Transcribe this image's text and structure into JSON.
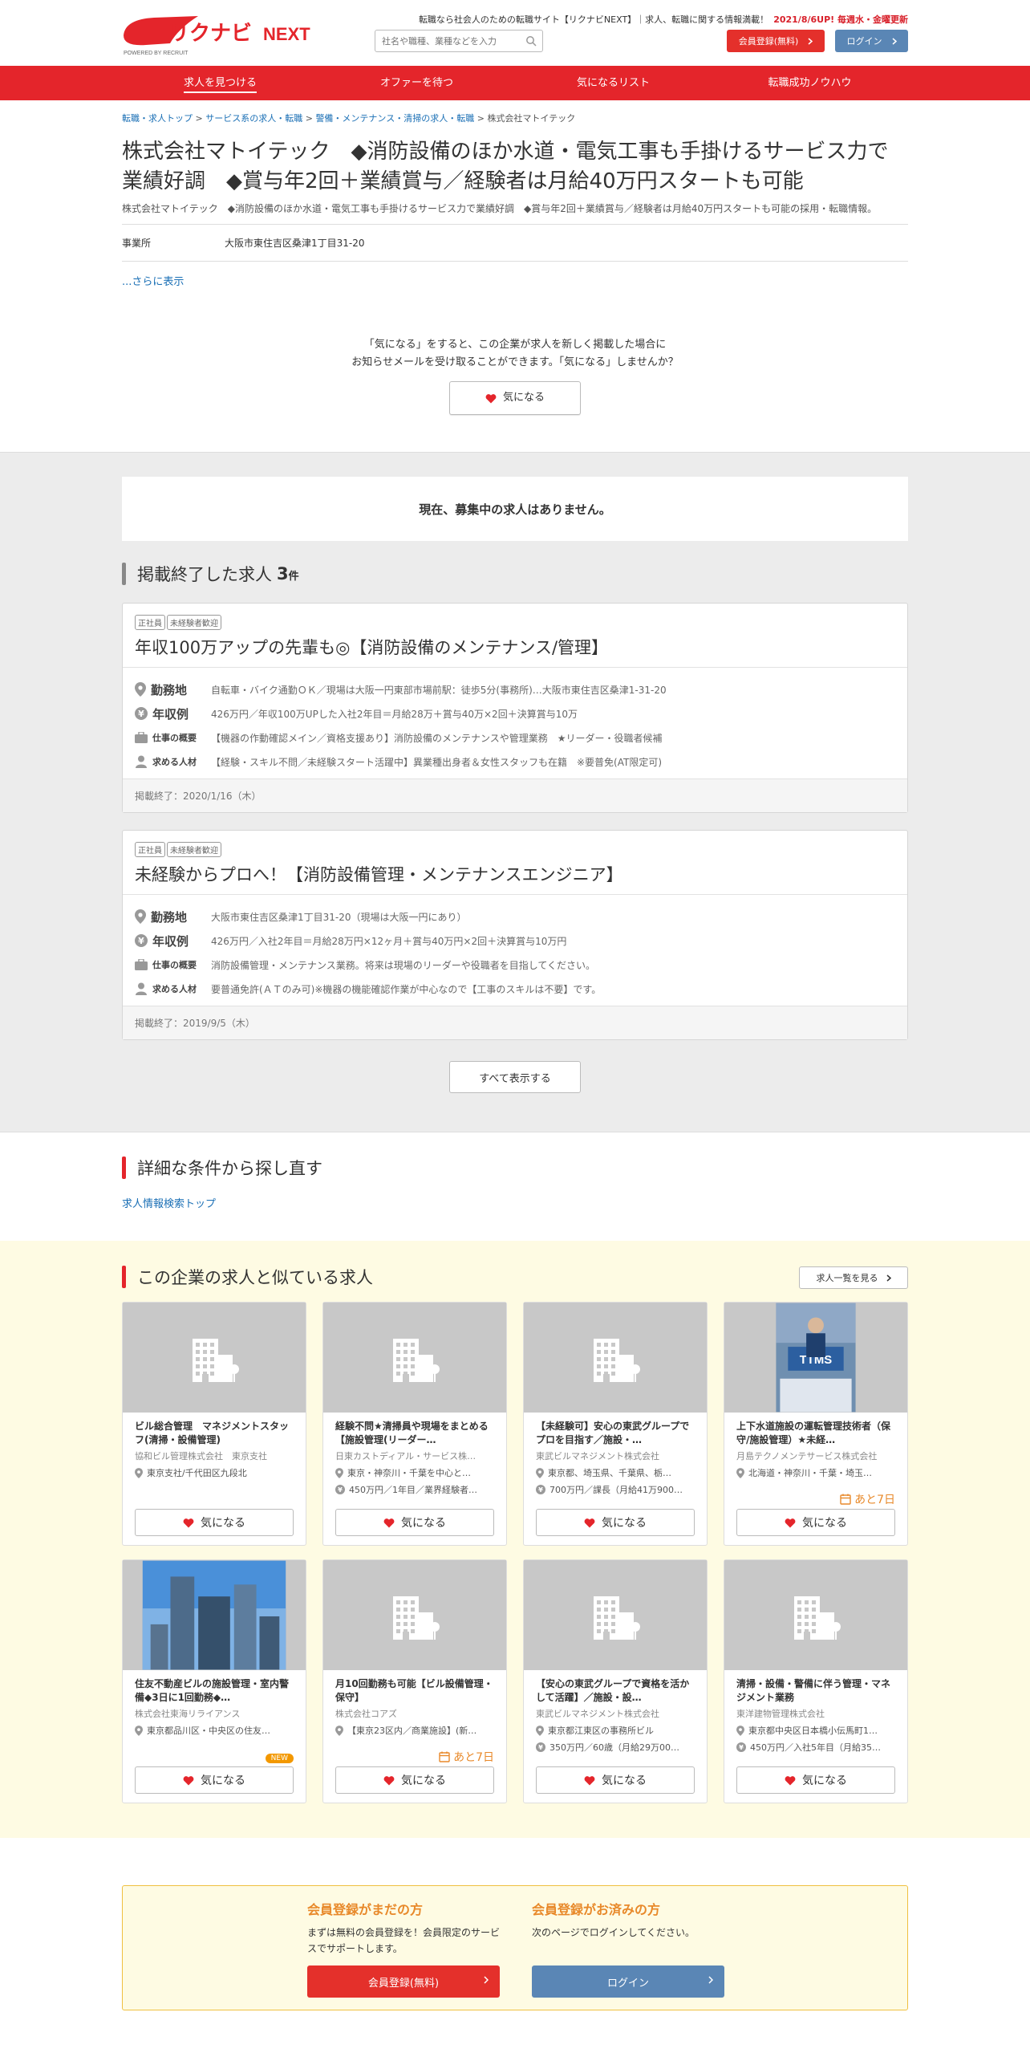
{
  "header": {
    "logo_text": "リクナビNEXT",
    "logo_sub": "POWERED BY RECRUIT",
    "tagline": "転職なら社会人のための転職サイト【リクナビNEXT】｜求人、転職に関する情報満載！",
    "tagline_highlight": "2021/8/6UP! 毎週水・金曜更新",
    "search_placeholder": "社名や職種、業種などを入力",
    "register_button": "会員登録(無料)",
    "login_button": "ログイン"
  },
  "nav": {
    "items": [
      "求人を見つける",
      "オファーを待つ",
      "気になるリスト",
      "転職成功ノウハウ"
    ]
  },
  "breadcrumb": {
    "items": [
      "転職・求人トップ",
      "サービス系の求人・転職",
      "警備・メンテナンス・清掃の求人・転職"
    ],
    "current": "株式会社マトイテック"
  },
  "company": {
    "title": "株式会社マトイテック　◆消防設備のほか水道・電気工事も手掛けるサービス力で業績好調　◆賞与年2回＋業績賞与／経験者は月給40万円スタートも可能",
    "description": "株式会社マトイテック　◆消防設備のほか水道・電気工事も手掛けるサービス力で業績好調　◆賞与年2回＋業績賞与／経験者は月給40万円スタートも可能の採用・転職情報。",
    "office_label": "事業所",
    "office_value": "大阪市東住吉区桑津1丁目31-20",
    "more_link": "...さらに表示"
  },
  "favorite": {
    "line1": "「気になる」をすると、この企業が求人を新しく掲載した場合に",
    "line2": "お知らせメールを受け取ることができます。「気になる」しませんか？",
    "button": "気になる"
  },
  "jobs": {
    "no_jobs_message": "現在、募集中の求人はありません。",
    "ended_title": "掲載終了した求人",
    "ended_count": "3",
    "ended_unit": "件",
    "labels": {
      "location": "勤務地",
      "salary": "年収例",
      "work": "仕事の概要",
      "requirements": "求める人材"
    },
    "cards": [
      {
        "tags": [
          "正社員",
          "未経験者歓迎"
        ],
        "title": "年収100万アップの先輩も◎【消防設備のメンテナンス/管理】",
        "location": "自転車・バイク通勤ＯＫ／現場は大阪一円東部市場前駅：徒歩5分(事務所)…大阪市東住吉区桑津1-31-20",
        "salary": "426万円／年収100万UPした入社2年目＝月給28万＋賞与40万×2回＋決算賞与10万",
        "work": "【機器の作動確認メイン／資格支援あり】消防設備のメンテナンスや管理業務　★リーダー・役職者候補",
        "requirements": "【経験・スキル不問／未経験スタート活躍中】異業種出身者＆女性スタッフも在籍　※要普免(AT限定可)",
        "ended": "掲載終了：2020/1/16（木）"
      },
      {
        "tags": [
          "正社員",
          "未経験者歓迎"
        ],
        "title": "未経験からプロへ！【消防設備管理・メンテナンスエンジニア】",
        "location": "大阪市東住吉区桑津1丁目31-20（現場は大阪一円にあり）",
        "salary": "426万円／入社2年目＝月給28万円×12ヶ月＋賞与40万円×2回＋決算賞与10万円",
        "work": "消防設備管理・メンテナンス業務。将来は現場のリーダーや役職者を目指してください。",
        "requirements": "要普通免許(ＡＴのみ可)※機器の機能確認作業が中心なので【工事のスキルは不要】です。",
        "ended": "掲載終了：2019/9/5（木）"
      }
    ],
    "show_all": "すべて表示する"
  },
  "detail_search": {
    "title": "詳細な条件から探し直す",
    "link": "求人情報検索トップ"
  },
  "similar": {
    "title": "この企業の求人と似ている求人",
    "list_button": "求人一覧を見る",
    "fav_label": "気になる",
    "cards": [
      {
        "title": "ビル総合管理　マネジメントスタッフ(清掃・設備管理)",
        "company": "協和ビル管理株式会社　東京支社",
        "location": "東京支社/千代田区九段北",
        "salary": "",
        "badge": "",
        "image": "placeholder"
      },
      {
        "title": "経験不問★清掃員や現場をまとめる【施設管理(リーダー…",
        "company": "日東カストディアル・サービス株…",
        "location": "東京・神奈川・千葉を中心と…",
        "salary": "450万円／1年目／業界経験者…",
        "badge": "",
        "image": "placeholder"
      },
      {
        "title": "【未経験可】安心の東武グループでプロを目指す／施設・…",
        "company": "東武ビルマネジメント株式会社",
        "location": "東京都、埼玉県、千葉県、栃…",
        "salary": "700万円／課長（月給41万900…",
        "badge": "",
        "image": "placeholder"
      },
      {
        "title": "上下水道施設の運転管理技術者（保守/施設管理）★未経…",
        "company": "月島テクノメンテサービス株式会社",
        "location": "北海道・神奈川・千葉・埼玉…",
        "salary": "",
        "badge": "あと7日",
        "image": "photo-ttms"
      },
      {
        "title": "住友不動産ビルの施設管理・室内警備◆3日に1回勤務◆…",
        "company": "株式会社東海リライアンス",
        "location": "東京都品川区・中央区の住友…",
        "salary": "",
        "badge": "NEW",
        "image": "photo-buildings"
      },
      {
        "title": "月10回勤務も可能【ビル設備管理・保守】",
        "company": "株式会社コアズ",
        "location": "【東京23区内／商業施設】(新…",
        "salary": "",
        "badge": "あと7日",
        "image": "placeholder"
      },
      {
        "title": "【安心の東武グループで資格を活かして活躍】／施設・設…",
        "company": "東武ビルマネジメント株式会社",
        "location": "東京都江東区の事務所ビル",
        "salary": "350万円／60歳（月給29万00…",
        "badge": "",
        "image": "placeholder"
      },
      {
        "title": "清掃・設備・警備に伴う管理・マネジメント業務",
        "company": "東洋建物管理株式会社",
        "location": "東京都中央区日本橋小伝馬町1…",
        "salary": "450万円／入社5年目（月給35…",
        "badge": "",
        "image": "placeholder"
      }
    ]
  },
  "member": {
    "not_registered_title": "会員登録がまだの方",
    "not_registered_text": "まずは無料の会員登録を！会員限定のサービスでサポートします。",
    "register_button": "会員登録(無料)",
    "registered_title": "会員登録がお済みの方",
    "registered_text": "次のページでログインしてください。",
    "login_button": "ログイン"
  },
  "colors": {
    "brand_red": "#e4252b",
    "login_blue": "#5a86b5",
    "accent_orange": "#e8892a",
    "similar_bg": "#fefbe3"
  }
}
